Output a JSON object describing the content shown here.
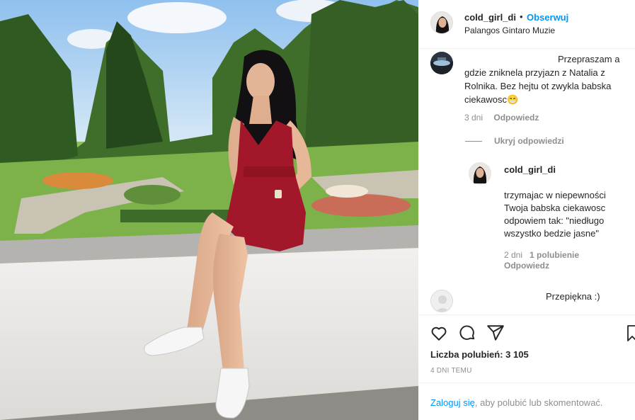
{
  "post": {
    "username": "cold_girl_di",
    "dot": "•",
    "follow_label": "Obserwuj",
    "location": "Palangos Gintaro Muzie"
  },
  "comments": [
    {
      "text": "Przepraszam a gdzie zniknela przyjazn z Natalia z Rolnika. Bez hejtu ot zwykla babska ciekawosc😁",
      "time": "3 dni",
      "reply_label": "Odpowiedz",
      "hide_replies_label": "Ukryj odpowiedzi"
    },
    {
      "text": "Przepiękna :)"
    }
  ],
  "reply": {
    "username": "cold_girl_di",
    "text": "trzymajac w niepewności Twoja babska ciekawosc odpowiem tak: \"niedługo wszystko bedzie jasne\"",
    "time": "2 dni",
    "likes": "1 polubienie",
    "reply_label": "Odpowiedz"
  },
  "actions": {
    "like_icon": "heart-icon",
    "comment_icon": "comment-icon",
    "share_icon": "share-icon",
    "save_icon": "bookmark-icon",
    "likes_text": "Liczba polubień: 3 105",
    "date_text": "4 DNI TEMU"
  },
  "footer": {
    "login_link": "Zaloguj się",
    "login_rest": ", aby polubić lub skomentować."
  },
  "colors": {
    "link_blue": "#0095f6",
    "muted_gray": "#8e8e8e",
    "text_dark": "#262626",
    "dress_red": "#a3172b"
  }
}
